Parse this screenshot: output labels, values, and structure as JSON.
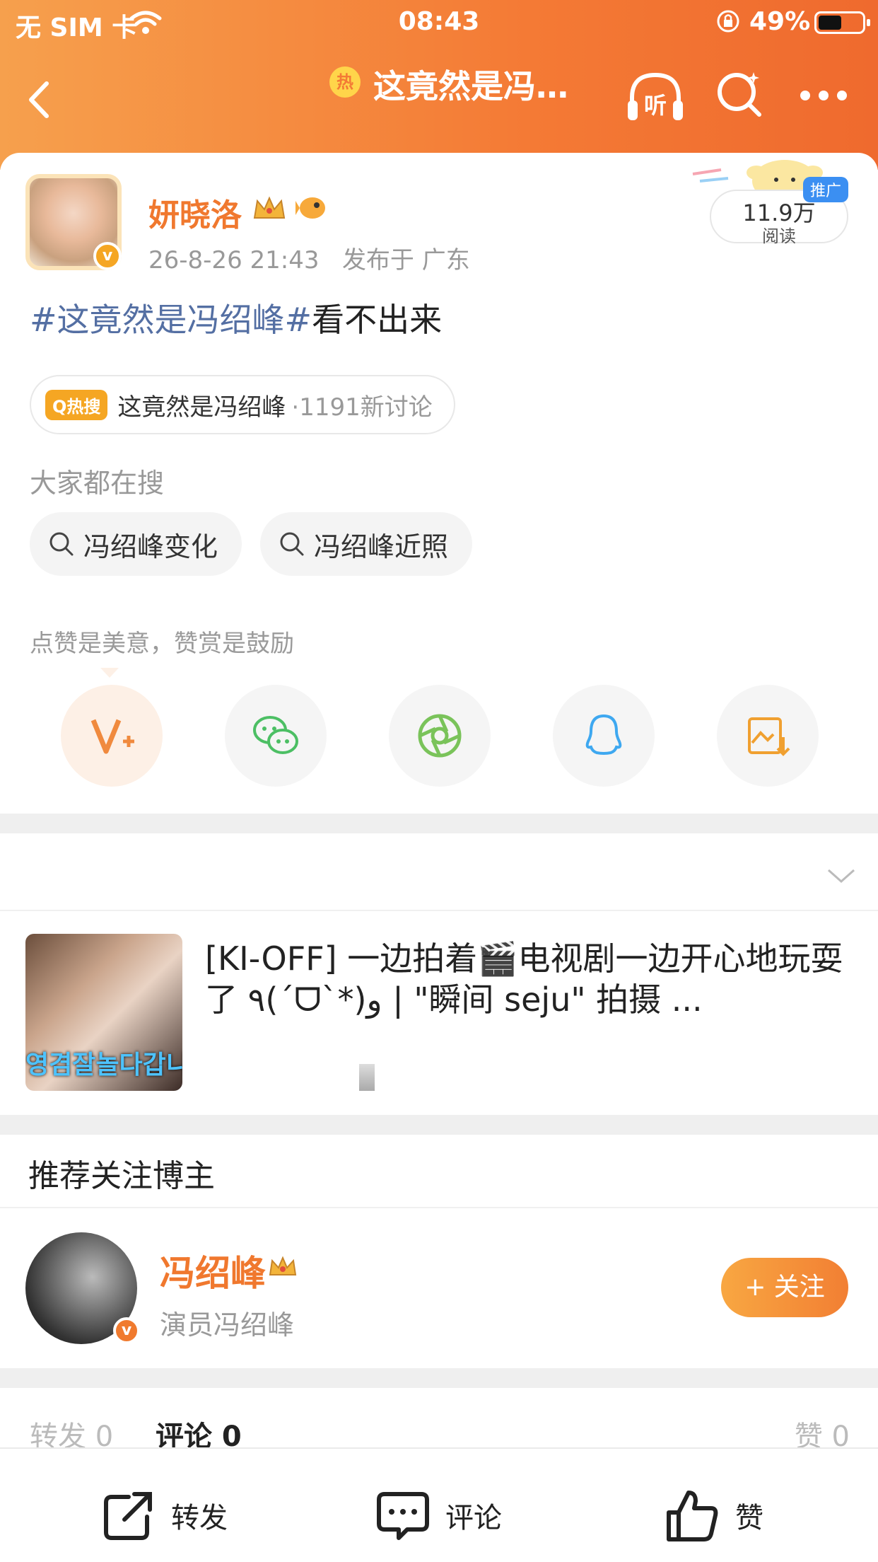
{
  "status": {
    "carrier": "无 SIM 卡",
    "time": "08:43",
    "battery_pct": "49%",
    "battery_level": 0.49
  },
  "nav": {
    "hot_badge": "热",
    "title": "这竟然是冯…",
    "listen_label": "听"
  },
  "post": {
    "author": "妍晓洛",
    "date": "26-8-26 21:43",
    "location": "发布于 广东",
    "views": "11.9万",
    "views_label": "阅读",
    "promo_tag": "推广",
    "topic": "#这竟然是冯绍峰#",
    "text": "看不出来"
  },
  "hot_pill": {
    "badge": "Q热搜",
    "label": "这竟然是冯绍峰",
    "count": "·1191新讨论"
  },
  "search": {
    "heading": "大家都在搜",
    "chips": [
      "冯绍峰变化",
      "冯绍峰近照"
    ]
  },
  "reward": {
    "hint": "点赞是美意，赞赏是鼓励"
  },
  "share_icons": [
    "v-plus-icon",
    "wechat-icon",
    "moments-icon",
    "qq-icon",
    "save-image-icon"
  ],
  "video": {
    "thumb_caption": "영겸잘놀다갑니",
    "title": "[KI-OFF] 一边拍着🎬电视剧一边开心地玩耍了 ٩(ˊᗜˋ*)و | \"瞬间 seju\" 拍摄 ..."
  },
  "recommend": {
    "heading": "推荐关注博主",
    "name": "冯绍峰",
    "desc": "演员冯绍峰",
    "follow_label": "+ 关注"
  },
  "stats": {
    "repost": "转发 0",
    "comment": "评论 0",
    "like": "赞 0"
  },
  "bottom_bar": {
    "repost": "转发",
    "comment": "评论",
    "like": "赞"
  },
  "colors": {
    "brand_orange": "#f47a35",
    "topic_blue": "#546fa3",
    "name_orange": "#f0782e"
  }
}
